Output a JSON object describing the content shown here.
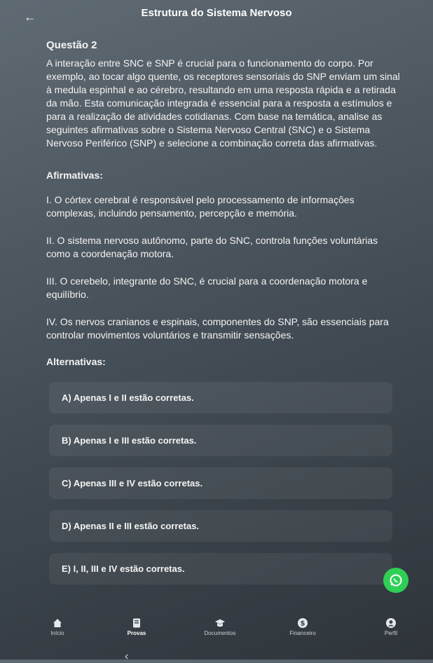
{
  "header": {
    "back_icon": "arrow-left-icon",
    "title": "Estrutura do Sistema Nervoso"
  },
  "question": {
    "label": "Questão 2",
    "text": "A interação entre SNC e SNP é crucial para o funcionamento do corpo. Por exemplo, ao tocar algo quente, os receptores sensoriais do SNP enviam um sinal à medula espinhal e ao cérebro, resultando em uma resposta rápida e a retirada da mão. Esta comunicação integrada é essencial para a resposta a estímulos e para a realização de atividades cotidianas. Com base na temática, analise as seguintes afirmativas sobre o Sistema Nervoso Central (SNC) e o Sistema Nervoso Periférico (SNP) e selecione a combinação correta das afirmativas."
  },
  "affirmations": {
    "heading": "Afirmativas:",
    "items": [
      "I. O córtex cerebral é responsável pelo processamento de informações complexas, incluindo pensamento, percepção e memória.",
      "II. O sistema nervoso autônomo, parte do SNC, controla funções voluntárias como a coordenação motora.",
      "III. O cerebelo, integrante do SNC, é crucial para a coordenação motora e equilíbrio.",
      "IV. Os nervos cranianos e espinais, componentes do SNP, são essenciais para controlar movimentos voluntários e transmitir sensações."
    ]
  },
  "alternatives": {
    "heading": "Alternativas:",
    "items": [
      "A) Apenas I e II estão corretas.",
      "B) Apenas I e III estão corretas.",
      "C) Apenas III e IV estão corretas.",
      "D) Apenas II e III estão corretas.",
      "E) I, II, III e IV estão corretas."
    ]
  },
  "fab": {
    "icon": "whatsapp-icon",
    "color": "#2fcf56"
  },
  "tabbar": {
    "tabs": [
      {
        "label": "Início",
        "icon": "home-icon"
      },
      {
        "label": "Provas",
        "icon": "exam-icon"
      },
      {
        "label": "Documentos",
        "icon": "graduation-cap-icon"
      },
      {
        "label": "Financeiro",
        "icon": "dollar-icon"
      },
      {
        "label": "Perfil",
        "icon": "user-icon"
      }
    ]
  },
  "system_nav": {
    "back_icon": "chevron-left-icon"
  }
}
